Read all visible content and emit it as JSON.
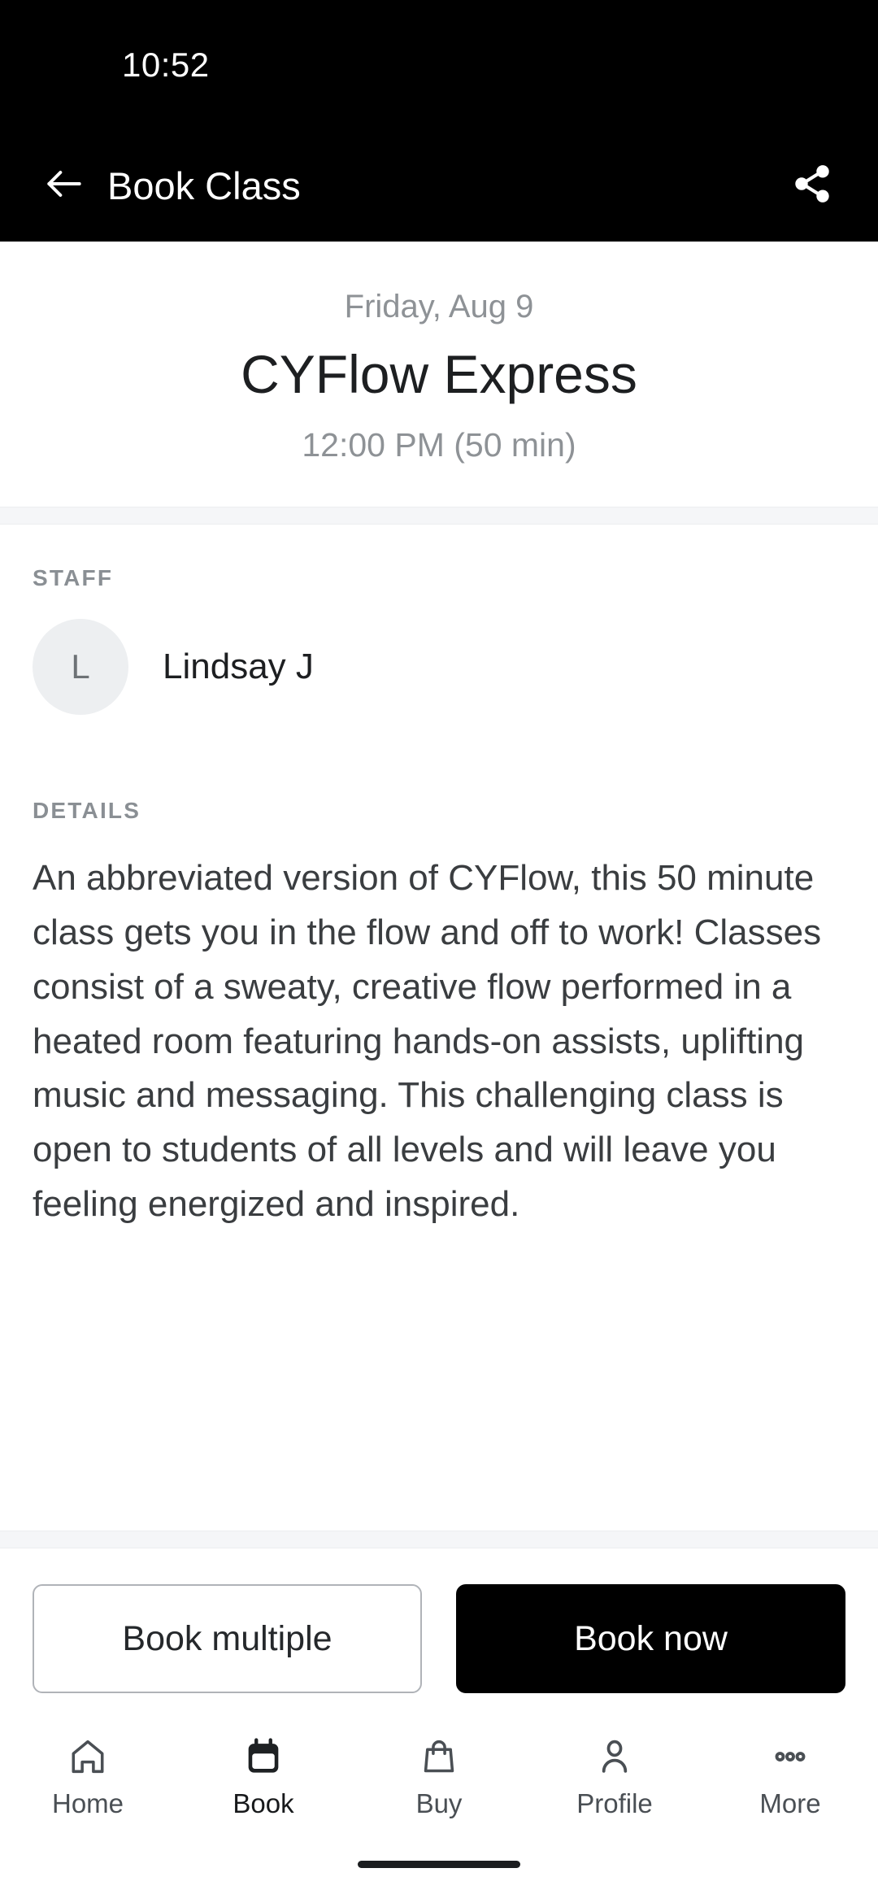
{
  "status_bar": {
    "time": "10:52"
  },
  "app_bar": {
    "title": "Book Class",
    "back_icon": "arrow-left-icon",
    "share_icon": "share-icon"
  },
  "class_header": {
    "date": "Friday, Aug 9",
    "name": "CYFlow Express",
    "time": "12:00 PM (50 min)"
  },
  "staff_section": {
    "label": "STAFF",
    "avatar_initial": "L",
    "name": "Lindsay J"
  },
  "details_section": {
    "label": "DETAILS",
    "description": "An abbreviated version of CYFlow, this 50 minute class gets you in the flow and off to work! Classes consist of a sweaty, creative flow performed in a heated room featuring hands-on assists, uplifting music and messaging. This challenging class is open to students of all levels and will leave you feeling energized and inspired."
  },
  "actions": {
    "secondary_label": "Book multiple",
    "primary_label": "Book now"
  },
  "bottom_nav": {
    "items": [
      {
        "label": "Home",
        "icon": "home-icon",
        "active": false
      },
      {
        "label": "Book",
        "icon": "calendar-icon",
        "active": true
      },
      {
        "label": "Buy",
        "icon": "shopping-bag-icon",
        "active": false
      },
      {
        "label": "Profile",
        "icon": "person-icon",
        "active": false
      },
      {
        "label": "More",
        "icon": "ellipsis-icon",
        "active": false
      }
    ]
  },
  "colors": {
    "app_bar_bg": "#000000",
    "primary_button_bg": "#000000",
    "muted_text": "#8e9296",
    "body_text": "#3a3d40",
    "avatar_bg": "#edeff1",
    "divider": "#f5f6f8",
    "nav_icon": "#4a4f54"
  }
}
